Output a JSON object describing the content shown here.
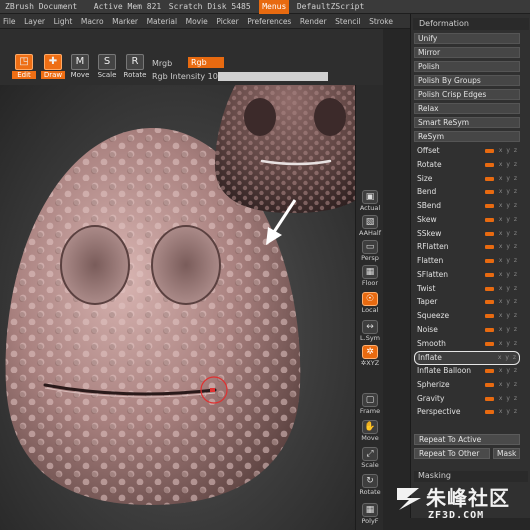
{
  "titlebar": {
    "app": "ZBrush Document",
    "mem": "Active Mem 821",
    "scratch": "Scratch Disk 5485",
    "menus": "Menus",
    "script": "DefaultZScript"
  },
  "menubar": [
    "File",
    "Layer",
    "Light",
    "Macro",
    "Marker",
    "Material",
    "Movie",
    "Picker",
    "Preferences",
    "Render",
    "Stencil",
    "Stroke"
  ],
  "toolbar": {
    "edit": "Edit",
    "draw": "Draw",
    "move": "Move",
    "scale": "Scale",
    "rotate": "Rotate",
    "mrgb": "Mrgb",
    "rgb": "Rgb",
    "rgb_intensity_label": "Rgb Intensity",
    "rgb_intensity_value": "100",
    "intensity_fraction": 1.0
  },
  "right_shelf": {
    "actual": "Actual",
    "aahalf": "AAHalf",
    "persp": "Persp",
    "floor": "Floor",
    "local": "Local",
    "lsym": "L.Sym",
    "xyz": "✲XYZ",
    "frame": "Frame",
    "move": "Move",
    "scale": "Scale",
    "rotate": "Rotate",
    "polyf": "PolyF"
  },
  "panel": {
    "title": "Deformation",
    "buttons": [
      "Unify",
      "Mirror",
      "Polish",
      "Polish By Groups",
      "Polish Crisp Edges",
      "Relax",
      "Smart ReSym",
      "ReSym"
    ],
    "sliders": [
      {
        "name": "Offset",
        "value": 0.5
      },
      {
        "name": "Rotate",
        "value": 0.5
      },
      {
        "name": "Size",
        "value": 0.5
      },
      {
        "name": "Bend",
        "value": 0.5
      },
      {
        "name": "SBend",
        "value": 0.5
      },
      {
        "name": "Skew",
        "value": 0.5
      },
      {
        "name": "SSkew",
        "value": 0.5
      },
      {
        "name": "RFlatten",
        "value": 0.5
      },
      {
        "name": "Flatten",
        "value": 0.5
      },
      {
        "name": "SFlatten",
        "value": 0.5
      },
      {
        "name": "Twist",
        "value": 0.5
      },
      {
        "name": "Taper",
        "value": 0.5
      },
      {
        "name": "Squeeze",
        "value": 0.5
      },
      {
        "name": "Noise",
        "value": 0.5
      },
      {
        "name": "Smooth",
        "value": 0.5
      },
      {
        "name": "Inflate",
        "value": 0.0
      },
      {
        "name": "Inflate Balloon",
        "value": 0.5
      },
      {
        "name": "Spherize",
        "value": 0.5
      },
      {
        "name": "Gravity",
        "value": 0.5
      },
      {
        "name": "Perspective",
        "value": 0.5
      }
    ],
    "axes_label": "x y z",
    "repeat_active": "Repeat To Active",
    "repeat_other": "Repeat To Other",
    "mask": "Mask",
    "masking": "Masking"
  },
  "watermark": {
    "chinese": "朱峰社区",
    "url": "ZF3D.COM"
  },
  "colors": {
    "accent": "#e86a10",
    "skin": "#b58c8a",
    "panel_bg": "#303030"
  }
}
